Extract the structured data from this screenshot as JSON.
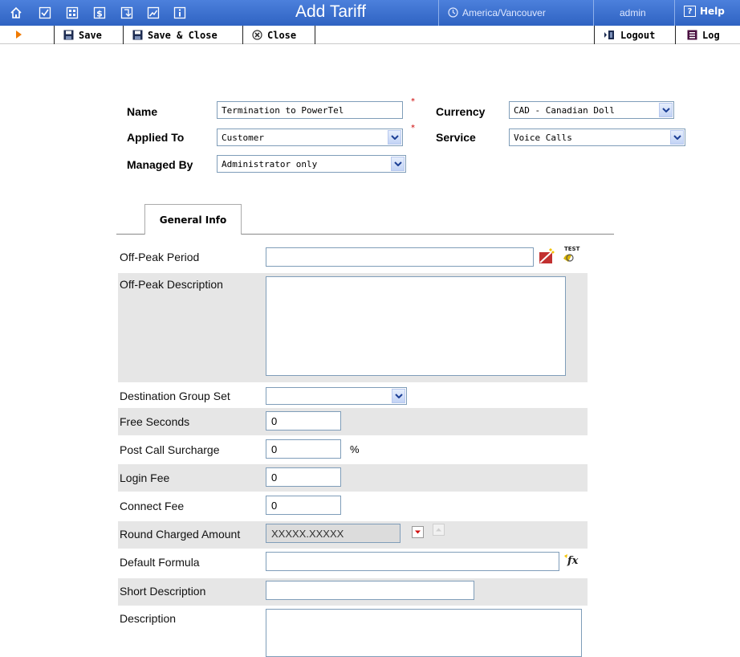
{
  "header": {
    "title": "Add Tariff",
    "timezone": "America/Vancouver",
    "user": "admin",
    "help_label": "Help",
    "help_icon_text": "?",
    "nav_icons": [
      "home-icon",
      "checklist-icon",
      "grid-icon",
      "dollar-icon",
      "export-icon",
      "chart-icon",
      "info-icon"
    ]
  },
  "toolbar": {
    "save_label": "Save",
    "save_close_label": "Save & Close",
    "close_label": "Close",
    "logout_label": "Logout",
    "log_label": "Log"
  },
  "form": {
    "name_label": "Name",
    "name_value": "Termination to PowerTel",
    "applied_to_label": "Applied To",
    "applied_to_value": "Customer",
    "managed_by_label": "Managed By",
    "managed_by_value": "Administrator only",
    "currency_label": "Currency",
    "currency_value": "CAD - Canadian Doll",
    "service_label": "Service",
    "service_value": "Voice Calls",
    "required_mark": "*"
  },
  "tabs": [
    {
      "label": "General Info",
      "active": true
    }
  ],
  "general": {
    "off_peak_period_label": "Off-Peak Period",
    "off_peak_period_value": "",
    "off_peak_description_label": "Off-Peak Description",
    "destination_group_set_label": "Destination Group Set",
    "destination_group_set_value": "",
    "free_seconds_label": "Free Seconds",
    "free_seconds_value": "0",
    "post_call_surcharge_label": "Post Call Surcharge",
    "post_call_surcharge_value": "0",
    "post_call_surcharge_unit": "%",
    "login_fee_label": "Login Fee",
    "login_fee_value": "0",
    "connect_fee_label": "Connect Fee",
    "connect_fee_value": "0",
    "round_charged_amount_label": "Round Charged Amount",
    "round_charged_amount_value": "XXXXX.XXXXX",
    "default_formula_label": "Default Formula",
    "default_formula_value": "",
    "short_description_label": "Short Description",
    "short_description_value": "",
    "description_label": "Description",
    "test_icon_text": "TEST",
    "formula_icon_text": "fx"
  }
}
